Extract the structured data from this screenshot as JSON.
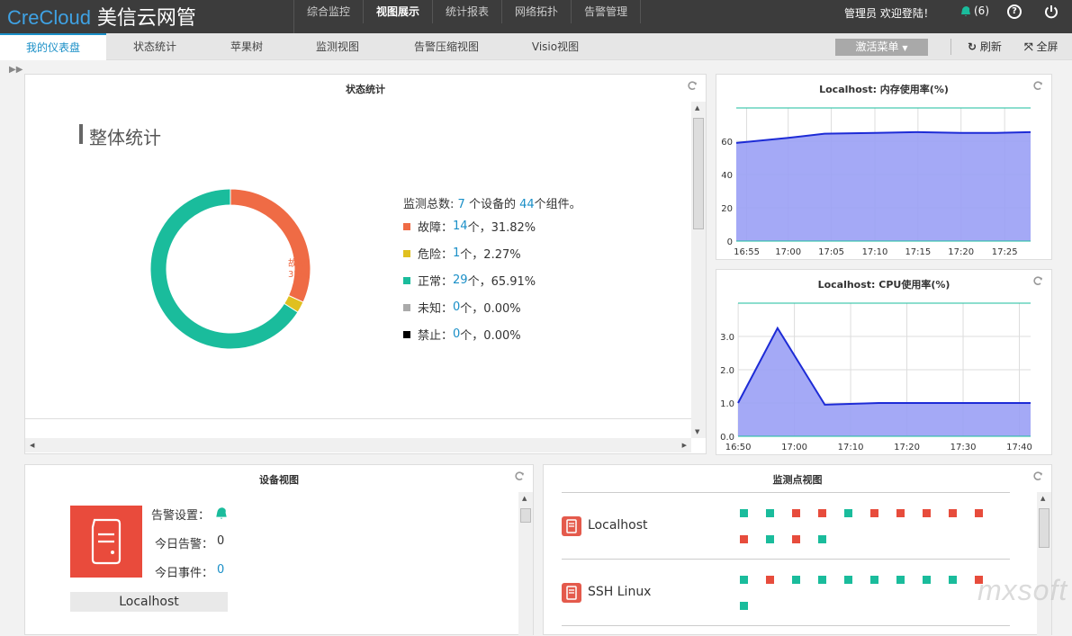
{
  "header": {
    "brand_en": "CreCloud",
    "brand_cn": " 美信云网管",
    "nav": [
      "综合监控",
      "视图展示",
      "统计报表",
      "网络拓扑",
      "告警管理"
    ],
    "active_nav": "视图展示",
    "user_text": "管理员 欢迎登陆！",
    "alert_count": "(6)"
  },
  "tabs": [
    "我的仪表盘",
    "状态统计",
    "苹果树",
    "监测视图",
    "告警压缩视图",
    "Visio视图"
  ],
  "active_tab": "我的仪表盘",
  "toolbar": {
    "activate_menu": "激活菜单",
    "refresh": "刷新",
    "fullscreen": "全屏"
  },
  "status_panel": {
    "title": "状态统计",
    "heading": "整体统计",
    "summary_prefix": "监测总数:",
    "device_count": "7",
    "summary_mid": "个设备的",
    "component_count": "44",
    "summary_suffix": "个组件。",
    "donut": [
      {
        "label": "故障",
        "percent_label": "32%",
        "value": 31.82,
        "color": "#ef6b45"
      },
      {
        "label": "危险",
        "percent_label": "2%",
        "value": 2.27,
        "color": "#e0c020"
      },
      {
        "label": "正常",
        "percent_label": "66%",
        "value": 65.91,
        "color": "#1abc9c"
      }
    ],
    "legend": [
      {
        "label": "故障：",
        "count": "14",
        "rest": " 个，31.82%",
        "color": "#ef6b45"
      },
      {
        "label": "危险：",
        "count": "1",
        "rest": " 个，2.27%",
        "color": "#e0c020"
      },
      {
        "label": "正常：",
        "count": "29",
        "rest": " 个，65.91%",
        "color": "#1abc9c"
      },
      {
        "label": "未知：",
        "count": "0",
        "rest": " 个，0.00%",
        "color": "#aaaaaa"
      },
      {
        "label": "禁止：",
        "count": "0",
        "rest": " 个，0.00%",
        "color": "#000000"
      }
    ]
  },
  "chart_data": [
    {
      "type": "area",
      "title": "Localhost: 内存使用率(%)",
      "xlabel": "",
      "ylabel": "",
      "x": [
        "16:55",
        "17:00",
        "17:05",
        "17:10",
        "17:15",
        "17:20",
        "17:25"
      ],
      "x_values": [
        16.92,
        17.0,
        17.083,
        17.167,
        17.25,
        17.333,
        17.417
      ],
      "series": [
        {
          "values": [
            [
              16.9,
              59
            ],
            [
              17.0,
              62
            ],
            [
              17.07,
              64.5
            ],
            [
              17.167,
              65
            ],
            [
              17.25,
              65.5
            ],
            [
              17.333,
              65
            ],
            [
              17.4,
              65
            ],
            [
              17.467,
              65.5
            ]
          ]
        }
      ],
      "yticks": [
        "0",
        "20",
        "40",
        "60"
      ],
      "ylim": [
        0,
        80
      ],
      "xlim": [
        16.9,
        17.467
      ],
      "grid": true,
      "fill_color": "#9aa0f5",
      "line_color": "#1d2bd6"
    },
    {
      "type": "area",
      "title": "Localhost: CPU使用率(%)",
      "xlabel": "",
      "ylabel": "",
      "x": [
        "16:50",
        "17:00",
        "17:10",
        "17:20",
        "17:30",
        "17:40"
      ],
      "series": [
        {
          "values": [
            [
              16.833,
              1.0
            ],
            [
              16.95,
              3.25
            ],
            [
              17.09,
              0.95
            ],
            [
              17.25,
              1.0
            ],
            [
              17.5,
              1.0
            ],
            [
              17.7,
              1.0
            ]
          ]
        }
      ],
      "yticks": [
        "0.0",
        "1.0",
        "2.0",
        "3.0"
      ],
      "ylim": [
        0,
        4
      ],
      "xlim": [
        16.833,
        17.7
      ],
      "grid": true,
      "fill_color": "#9aa0f5",
      "line_color": "#1d2bd6"
    }
  ],
  "device_panel": {
    "title": "设备视图",
    "alarm_setting": "告警设置：",
    "today_alarm": "今日告警：",
    "today_alarm_value": "0",
    "today_event": "今日事件：",
    "today_event_value": "0",
    "device_name": "Localhost"
  },
  "monitor_panel": {
    "title": "监测点视图",
    "rows": [
      {
        "name": "Localhost",
        "line1": [
          "g",
          "g",
          "r",
          "r",
          "g",
          "r",
          "r",
          "r",
          "r",
          "r"
        ],
        "line2": [
          "r",
          "g",
          "r",
          "g"
        ]
      },
      {
        "name": "SSH Linux",
        "line1": [
          "g",
          "r",
          "g",
          "g",
          "g",
          "g",
          "g",
          "g",
          "g",
          "r"
        ],
        "line2": [
          "g"
        ]
      }
    ]
  },
  "watermark": "mxsoft"
}
